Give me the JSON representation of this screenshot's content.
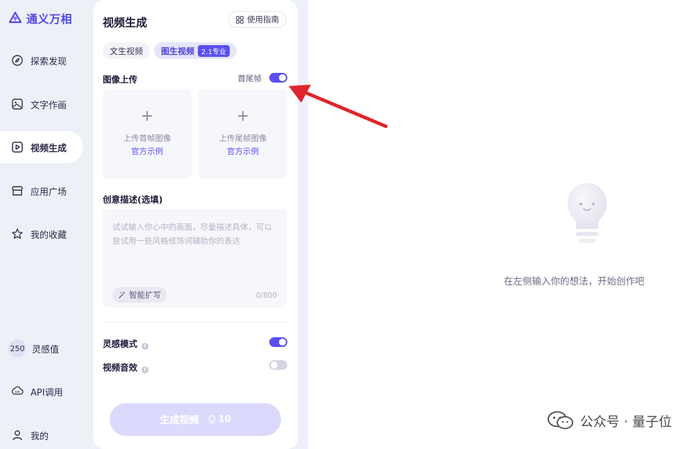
{
  "app": {
    "name": "通义万相"
  },
  "sidebar": {
    "items": [
      {
        "label": "探索发现",
        "icon": "compass-icon"
      },
      {
        "label": "文字作画",
        "icon": "image-icon"
      },
      {
        "label": "视频生成",
        "icon": "play-icon",
        "active": true
      },
      {
        "label": "应用广场",
        "icon": "store-icon"
      },
      {
        "label": "我的收藏",
        "icon": "star-icon"
      }
    ],
    "credits": {
      "value": "250",
      "label": "灵感值"
    },
    "api": {
      "label": "API调用",
      "icon": "api-icon"
    },
    "profile": {
      "label": "我的",
      "icon": "user-icon"
    }
  },
  "panel": {
    "title": "视频生成",
    "guide_label": "使用指南",
    "tabs": [
      {
        "label": "文生视频",
        "active": false
      },
      {
        "label": "图生视频",
        "active": true,
        "badge": "2.1专业"
      }
    ],
    "image_upload": {
      "label": "图像上传",
      "toggle_label": "首尾帧",
      "toggle_on": true,
      "first_frame": {
        "text": "上传首帧图像",
        "link": "官方示例"
      },
      "last_frame": {
        "text": "上传尾帧图像",
        "link": "官方示例"
      }
    },
    "description": {
      "label": "创意描述(选填)",
      "placeholder": "试试输入你心中的画面，尽量描述具体，可以尝试用一些风格修饰词辅助你的表达",
      "expand_label": "智能扩写",
      "char_count": "0/800"
    },
    "inspiration_mode": {
      "label": "灵感模式",
      "on": true
    },
    "video_sound": {
      "label": "视频音效",
      "on": false
    },
    "generate": {
      "label": "生成视频",
      "cost": "10"
    }
  },
  "main": {
    "empty_hint": "在左侧输入你的想法，开始创作吧"
  },
  "watermark": {
    "text": "公众号 · 量子位"
  },
  "colors": {
    "accent": "#5a4ff0",
    "sidebar_bg": "#eef0f8",
    "arrow": "#e0242b",
    "button_disabled": "#dcdafc"
  }
}
